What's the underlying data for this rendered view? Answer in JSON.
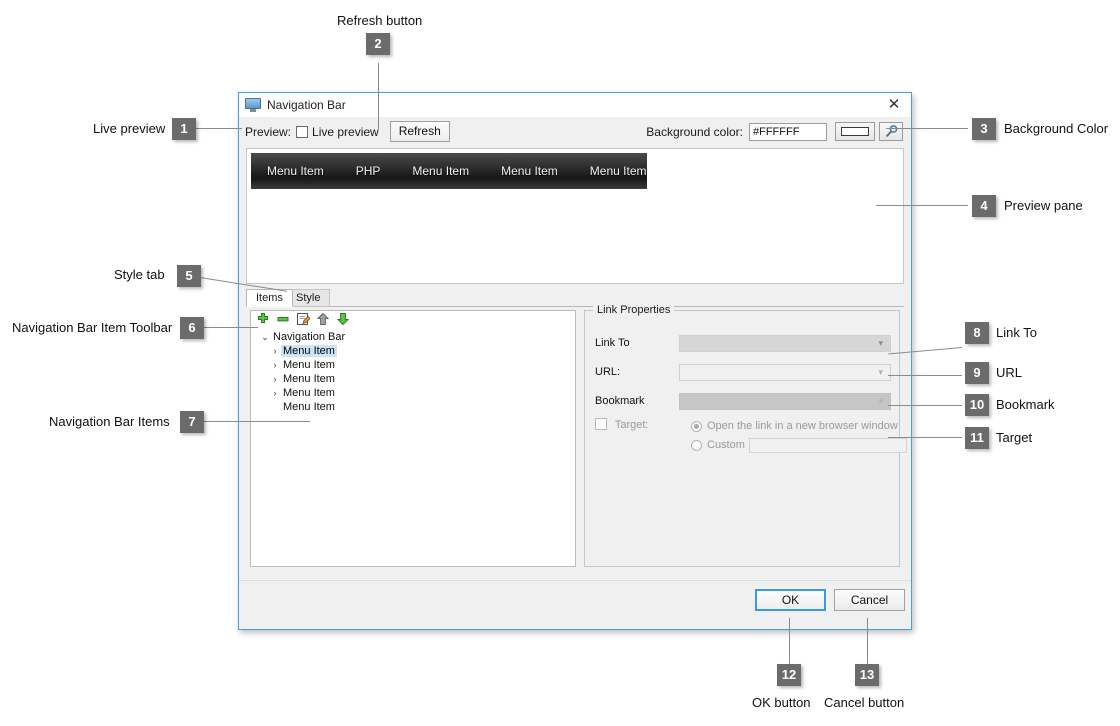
{
  "dialog": {
    "title": "Navigation Bar",
    "title_icon": "monitor-icon",
    "close_icon": "close-icon",
    "toolstrip": {
      "preview_label": "Preview:",
      "live_preview_label": "Live preview",
      "live_preview_checked": false,
      "refresh_label": "Refresh",
      "background_color_label": "Background color:",
      "background_color_value": "#FFFFFF",
      "color_swatch_hex": "#FFFFFF",
      "picker_icon": "eyedropper-icon"
    },
    "preview": {
      "menu_items": [
        "Menu Item",
        "PHP",
        "Menu Item",
        "Menu Item",
        "Menu Item"
      ]
    },
    "tabs": [
      {
        "label": "Items",
        "active": true
      },
      {
        "label": "Style",
        "active": false
      }
    ],
    "item_toolbar": [
      {
        "icon": "add-icon"
      },
      {
        "icon": "remove-icon"
      },
      {
        "icon": "edit-icon"
      },
      {
        "icon": "move-up-icon"
      },
      {
        "icon": "move-down-icon"
      }
    ],
    "tree": {
      "root": {
        "label": "Navigation Bar",
        "twisty": "⌄"
      },
      "children": [
        {
          "label": "Menu Item",
          "twisty": "›",
          "selected": true
        },
        {
          "label": "Menu Item",
          "twisty": "›",
          "selected": false
        },
        {
          "label": "Menu Item",
          "twisty": "›",
          "selected": false
        },
        {
          "label": "Menu Item",
          "twisty": "›",
          "selected": false
        },
        {
          "label": "Menu Item",
          "twisty": "",
          "selected": false
        }
      ]
    },
    "link_properties": {
      "group_title": "Link Properties",
      "link_to_label": "Link To",
      "link_to_value": "",
      "url_label": "URL:",
      "url_value": "",
      "bookmark_label": "Bookmark",
      "bookmark_value": "",
      "target_label": "Target:",
      "target_checked": false,
      "radio_new_window": "Open the link in a new browser window",
      "radio_new_window_selected": true,
      "radio_custom": "Custom",
      "radio_custom_selected": false,
      "custom_value": ""
    },
    "buttons": {
      "ok_label": "OK",
      "cancel_label": "Cancel"
    }
  },
  "callouts": [
    {
      "num": "1",
      "label": "Live preview"
    },
    {
      "num": "2",
      "label": "Refresh button"
    },
    {
      "num": "3",
      "label": "Background Color"
    },
    {
      "num": "4",
      "label": "Preview pane"
    },
    {
      "num": "5",
      "label": "Style tab"
    },
    {
      "num": "6",
      "label": "Navigation Bar Item Toolbar"
    },
    {
      "num": "7",
      "label": "Navigation Bar Items"
    },
    {
      "num": "8",
      "label": "Link To"
    },
    {
      "num": "9",
      "label": "URL"
    },
    {
      "num": "10",
      "label": "Bookmark"
    },
    {
      "num": "11",
      "label": "Target"
    },
    {
      "num": "12",
      "label": "OK button"
    },
    {
      "num": "13",
      "label": "Cancel button"
    }
  ]
}
